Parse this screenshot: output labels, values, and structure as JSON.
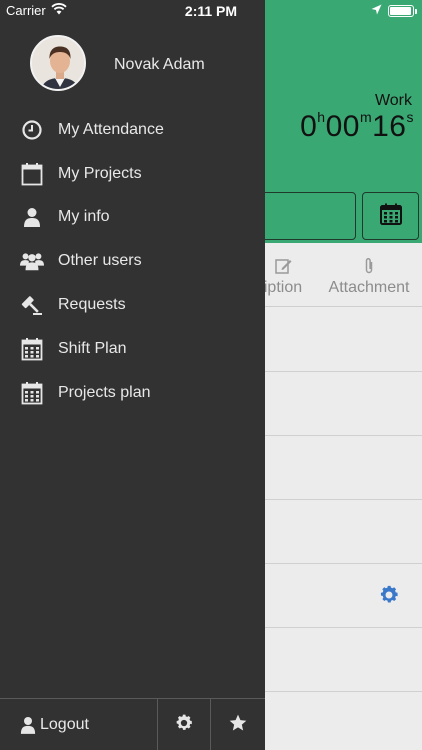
{
  "status_bar": {
    "carrier": "Carrier",
    "time": "2:11 PM",
    "battery_level": 0.95
  },
  "main": {
    "work_label": "Work",
    "timer": {
      "hours": "0",
      "h_unit": "h",
      "minutes": "00",
      "m_unit": "m",
      "seconds": "16",
      "s_unit": "s"
    },
    "tabs": [
      {
        "label": "iption",
        "icon": "edit-icon"
      },
      {
        "label": "Attachment",
        "icon": "paperclip-icon"
      }
    ],
    "accent_color": "#3aa873",
    "gear_color": "#3a78c9"
  },
  "drawer": {
    "user_name": "Novak Adam",
    "menu": [
      {
        "label": "My Attendance",
        "icon": "clock-icon"
      },
      {
        "label": "My Projects",
        "icon": "calendar-outline-icon"
      },
      {
        "label": "My info",
        "icon": "user-icon"
      },
      {
        "label": "Other users",
        "icon": "users-icon"
      },
      {
        "label": "Requests",
        "icon": "gavel-icon"
      },
      {
        "label": "Shift Plan",
        "icon": "calendar-grid-icon"
      },
      {
        "label": "Projects plan",
        "icon": "calendar-grid-icon"
      }
    ],
    "footer": {
      "logout_label": "Logout",
      "settings_icon": "gear-icon",
      "favorites_icon": "star-icon"
    }
  }
}
